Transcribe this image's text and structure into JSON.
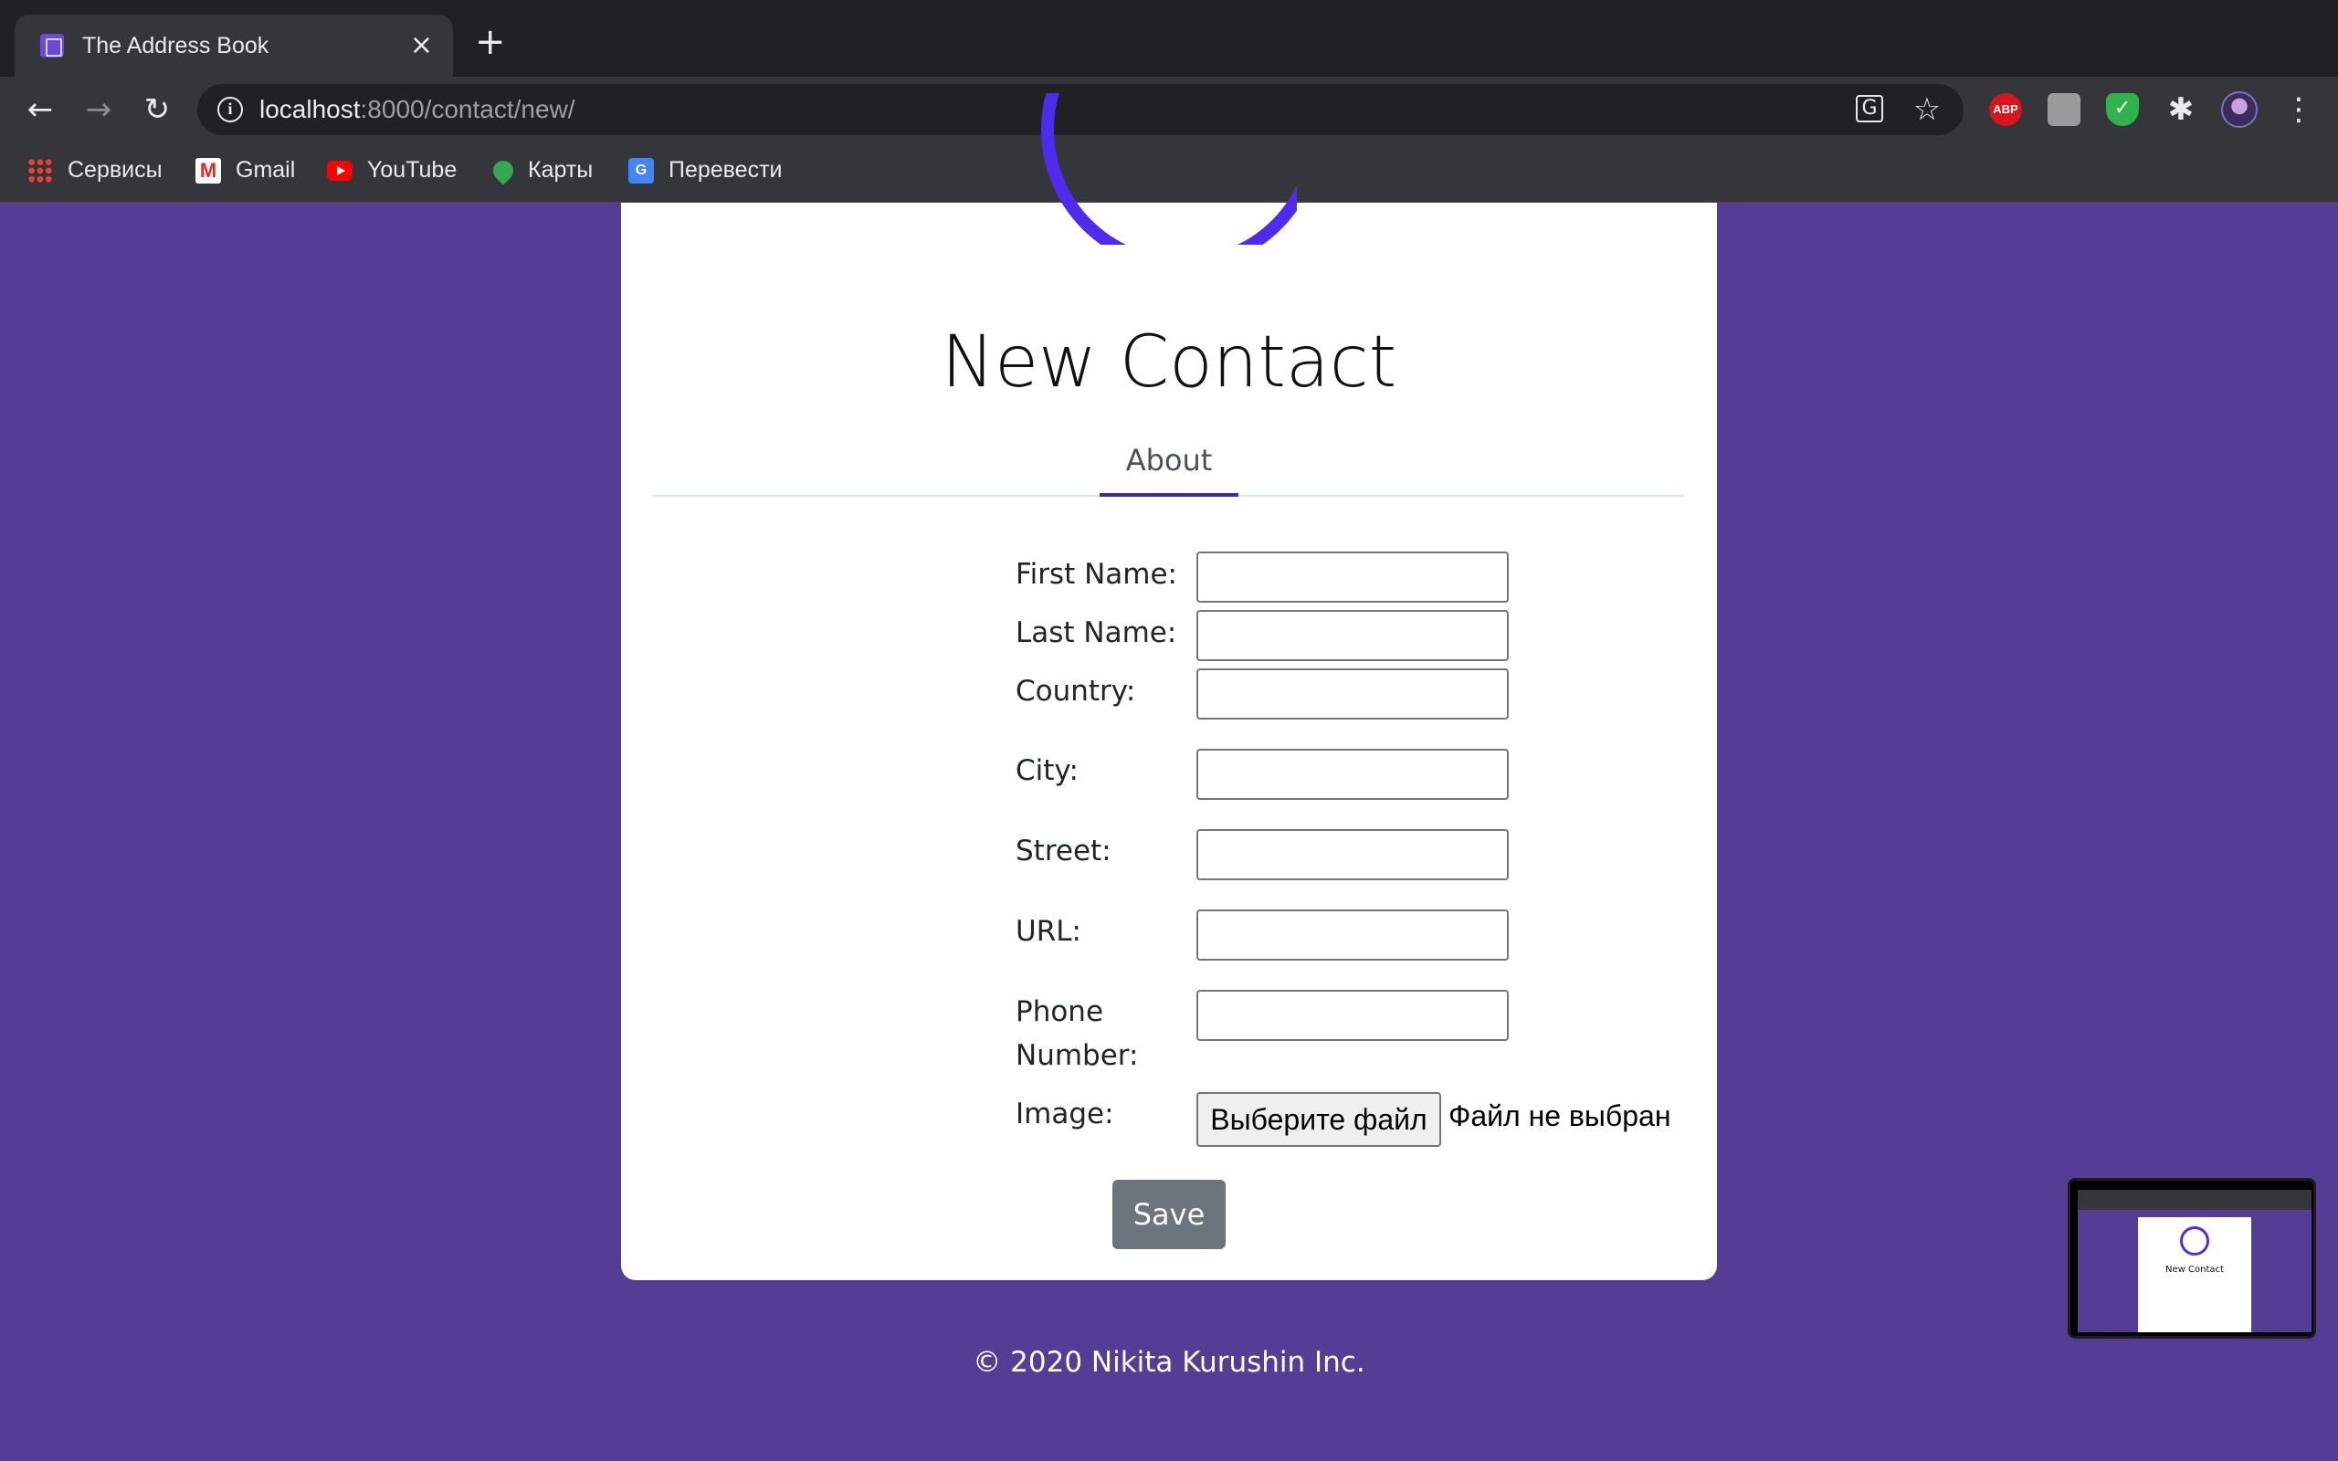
{
  "browser": {
    "tab_title": "The Address Book",
    "tab_close": "×",
    "new_tab": "+",
    "url_host": "localhost",
    "url_path": ":8000/contact/new/",
    "bookmarks": [
      {
        "label": "Сервисы",
        "icon": "apps-icon"
      },
      {
        "label": "Gmail",
        "icon": "gmail-icon"
      },
      {
        "label": "YouTube",
        "icon": "youtube-icon"
      },
      {
        "label": "Карты",
        "icon": "maps-icon"
      },
      {
        "label": "Перевести",
        "icon": "translate-icon"
      }
    ],
    "extensions": {
      "abp": "ABP"
    }
  },
  "page": {
    "title": "New Contact",
    "tabs": [
      {
        "label": "About"
      }
    ],
    "form": {
      "fields": [
        {
          "label": "First Name:",
          "value": ""
        },
        {
          "label": "Last Name:",
          "value": ""
        },
        {
          "label": "Country:",
          "value": ""
        },
        {
          "label": "City:",
          "value": ""
        },
        {
          "label": "Street:",
          "value": ""
        },
        {
          "label": "URL:",
          "value": ""
        },
        {
          "label": "Phone Number:",
          "value": ""
        }
      ],
      "image_label": "Image:",
      "file_button": "Выберите файл",
      "file_status": "Файл не выбран",
      "save_label": "Save"
    },
    "footer": "© 2020 Nikita Kurushin Inc.",
    "thumbnail_title": "New Contact"
  },
  "colors": {
    "background": "#553d96",
    "accent": "#4f2bf0",
    "tab_underline": "#4527a0",
    "save_button": "#6c757d"
  }
}
